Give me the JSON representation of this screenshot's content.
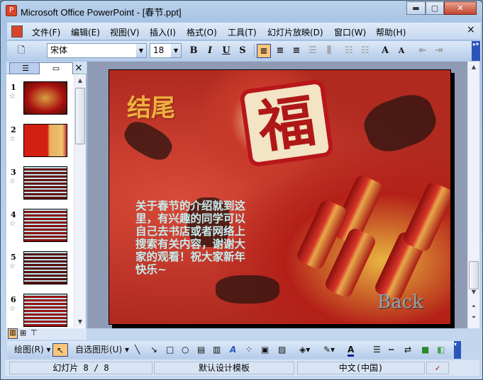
{
  "window": {
    "title": "Microsoft Office PowerPoint - [春节.ppt]",
    "minimize": "▬",
    "maximize": "▢",
    "close": "✕"
  },
  "menu": [
    "文件(F)",
    "编辑(E)",
    "视图(V)",
    "插入(I)",
    "格式(O)",
    "工具(T)",
    "幻灯片放映(D)",
    "窗口(W)",
    "帮助(H)"
  ],
  "menu_close": "×",
  "format": {
    "font": "宋体",
    "size": "18",
    "bold": "B",
    "italic": "I",
    "underline": "U",
    "shadow": "S",
    "increase_font": "A",
    "decrease_font": "A"
  },
  "pane": {
    "tab_close": "×",
    "slides": [
      {
        "num": "1"
      },
      {
        "num": "2"
      },
      {
        "num": "3"
      },
      {
        "num": "4"
      },
      {
        "num": "5"
      },
      {
        "num": "6"
      }
    ]
  },
  "slide": {
    "title": "结尾",
    "body": "关于春节的介绍就到这里，有兴趣的同学可以自己去书店或者网络上搜索有关内容，谢谢大家的观看！祝大家新年快乐~",
    "back": "Back",
    "fu": "福"
  },
  "draw": {
    "draw_label": "绘图(R)",
    "autoshapes_label": "自选图形(U)"
  },
  "status": {
    "slide": "幻灯片 8 / 8",
    "template": "默认设计模板",
    "language": "中文(中国)"
  }
}
